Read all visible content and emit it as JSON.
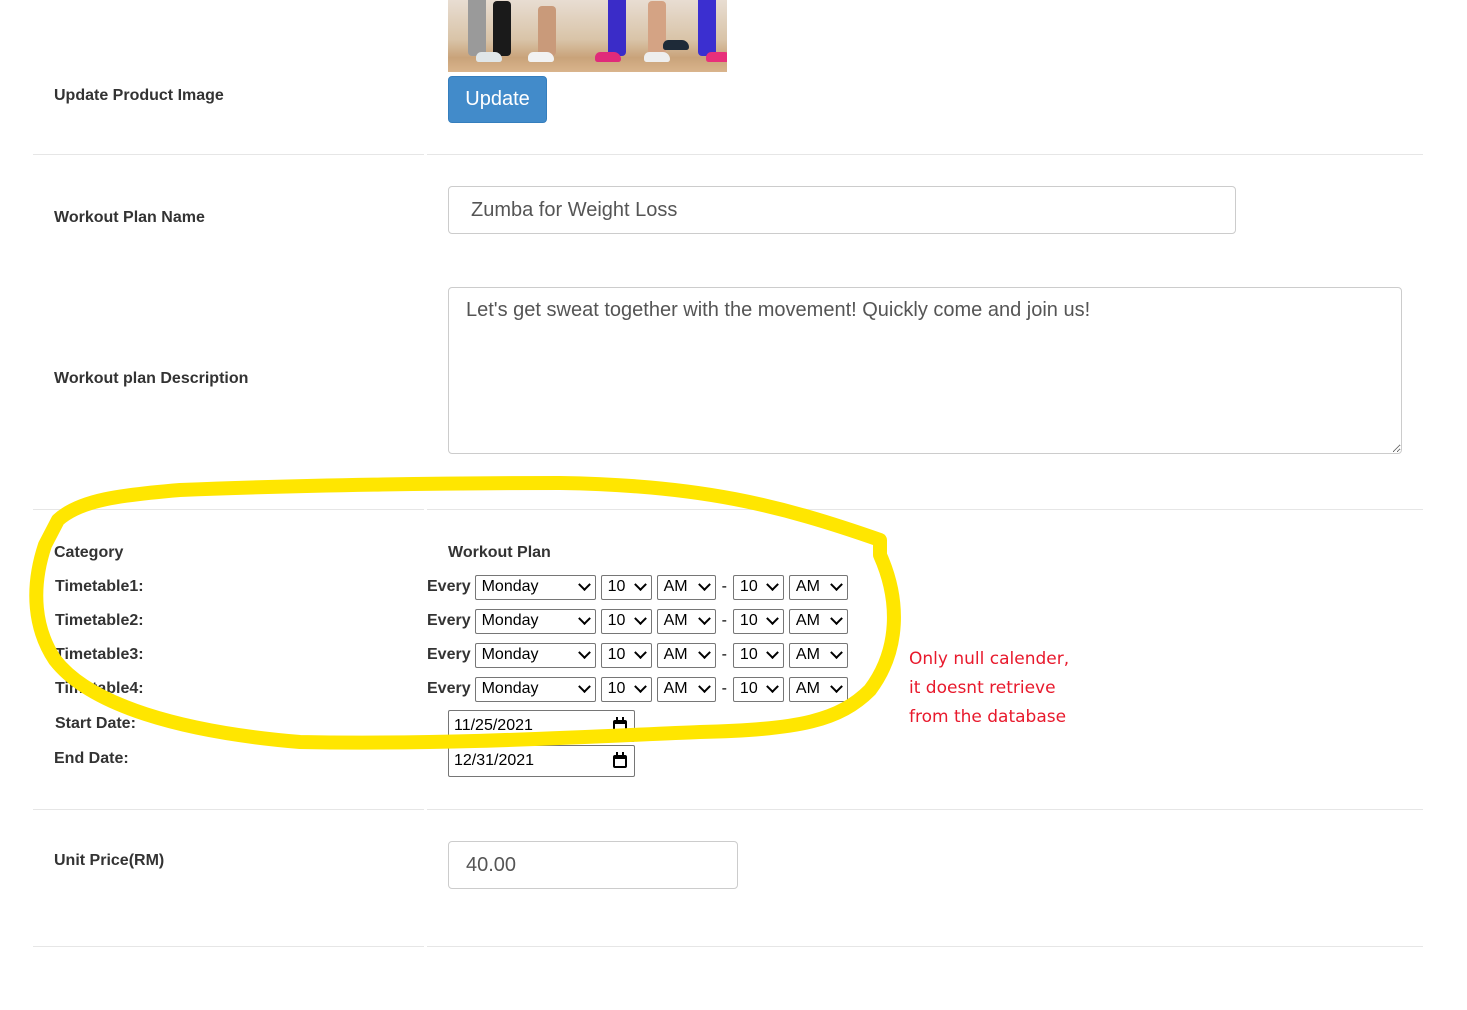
{
  "product_image": {
    "label": "Update Product Image",
    "alt": "Zumba dancers feet",
    "update_button": "Update"
  },
  "workout_plan_name": {
    "label": "Workout Plan Name",
    "value": "Zumba for Weight Loss"
  },
  "description": {
    "label": "Workout plan Description",
    "value": "Let's get sweat together with the movement! Quickly come and join us!"
  },
  "schedule": {
    "category_label": "Category",
    "category_value": "Workout Plan",
    "every_label": "Every",
    "separator": "-",
    "timetables": [
      {
        "label": "Timetable1:",
        "day": "Monday",
        "start_hour": "10",
        "start_ampm": "AM",
        "end_hour": "10",
        "end_ampm": "AM"
      },
      {
        "label": "Timetable2:",
        "day": "Monday",
        "start_hour": "10",
        "start_ampm": "AM",
        "end_hour": "10",
        "end_ampm": "AM"
      },
      {
        "label": "Timetable3:",
        "day": "Monday",
        "start_hour": "10",
        "start_ampm": "AM",
        "end_hour": "10",
        "end_ampm": "AM"
      },
      {
        "label": "Timetable4:",
        "day": "Monday",
        "start_hour": "10",
        "start_ampm": "AM",
        "end_hour": "10",
        "end_ampm": "AM"
      }
    ],
    "start_date_label": "Start Date:",
    "start_date": "11/25/2021",
    "end_date_label": "End Date:",
    "end_date": "12/31/2021"
  },
  "unit_price": {
    "label": "Unit Price(RM)",
    "value": "40.00"
  },
  "annotation": {
    "note_lines": [
      "Only null calender,",
      "it doesnt retrieve",
      "from the database"
    ],
    "highlight_color": "#ffe600",
    "note_color": "#e8192c"
  },
  "colors": {
    "primary_button": "#428bca"
  }
}
